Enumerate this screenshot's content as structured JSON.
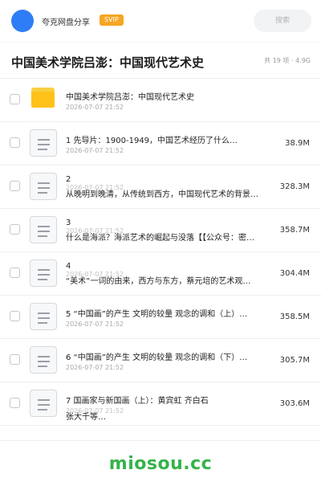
{
  "topbar": {
    "share_name": "夸克网盘分享",
    "badge": "SVIP",
    "search_placeholder": "搜索",
    "avatar_color": "#2f7df6",
    "badge_color": "#f5a623"
  },
  "folder_header": {
    "title": "中国美术学院吕澎：中国现代艺术史",
    "meta": "共 19 项 · 4.9G"
  },
  "items": [
    {
      "icon": "folder-icon",
      "name": "中国美术学院吕澎：中国现代艺术史",
      "date": "2026-07-07 21:52",
      "size": ""
    },
    {
      "icon": "document-icon",
      "name": "1 先导片：1900-1949，中国艺术经历了什么…",
      "date": "2026-07-07 21:52",
      "size": "38.9M"
    },
    {
      "icon": "document-icon",
      "num": "2",
      "date": "2026-07-07 21:52",
      "name": "从晚明到晚清，从传统到西方，中国现代艺术的背景…",
      "size": "328.3M"
    },
    {
      "icon": "document-icon",
      "num": "3",
      "date": "2026-07-07 21:52",
      "name": "什么是海派？海派艺术的崛起与没落【【公众号：密…",
      "size": "358.7M"
    },
    {
      "icon": "document-icon",
      "num": "4",
      "date": "2026-07-07 21:52",
      "name": "“美术”一词的由来，西方与东方，蔡元培的艺术观…",
      "size": "304.4M"
    },
    {
      "icon": "document-icon",
      "name": "5 “中国画”的产生 文明的较量 观念的调和（上）…",
      "date": "2026-07-07 21:52",
      "size": "358.5M"
    },
    {
      "icon": "document-icon",
      "name": "6 “中国画”的产生 文明的较量 观念的调和（下）…",
      "date": "2026-07-07 21:52",
      "size": "305.7M"
    },
    {
      "icon": "document-icon",
      "name": "7 国画家与新国画（上）：黄宾虹 齐白石",
      "date": "2026-07-07 21:52",
      "name2": "张大千等…",
      "size": "303.6M"
    }
  ],
  "watermark": "miosou.cc",
  "watermark_color": "#35b34a"
}
